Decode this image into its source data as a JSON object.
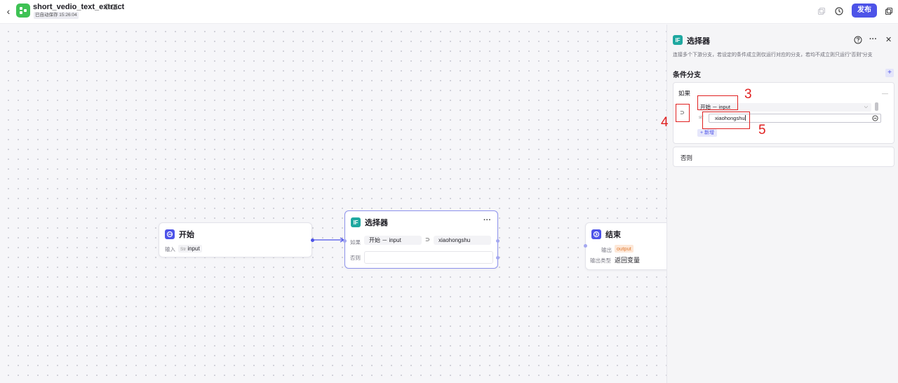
{
  "header": {
    "title": "short_vedio_text_extract",
    "autosave": "已自动保存 15:26:04",
    "publish_label": "发布"
  },
  "canvas": {
    "start_node": {
      "title": "开始",
      "input_label": "输入",
      "input_type": "Str",
      "input_name": "input"
    },
    "selector_node": {
      "title": "选择器",
      "more": "···",
      "if_label": "如果",
      "else_label": "否则",
      "left_operand": "开始 － input",
      "operator": "⊃",
      "right_operand": "xiaohongshu"
    },
    "end_node": {
      "title": "结束",
      "output_label": "输出",
      "output_name": "output",
      "output_type_label": "输出类型",
      "output_type_value": "返回变量"
    }
  },
  "panel": {
    "icon_text": "IF",
    "title": "选择器",
    "more": "···",
    "close": "✕",
    "description": "连接多个下游分支，若设定的条件成立则仅运行对应的分支，若均不成立则只运行“否则”分支",
    "section_title": "条件分支",
    "add_branch": "+",
    "if_branch": {
      "label": "如果",
      "collapse": "—",
      "operator": "⊃",
      "left_select": "开始 － input",
      "value_prefix": "str",
      "value": "xiaohongshu",
      "add_condition": "+ 新增"
    },
    "else_branch": {
      "label": "否则"
    }
  },
  "annotations": {
    "n3": "3",
    "n4": "4",
    "n5": "5"
  },
  "colors": {
    "accent": "#4d53e8",
    "selector_icon": "#1fa8a0",
    "logo": "#3ec254",
    "annotation": "#e02020",
    "output_tag_bg": "#fde8d8",
    "output_tag_fg": "#e07b33"
  }
}
